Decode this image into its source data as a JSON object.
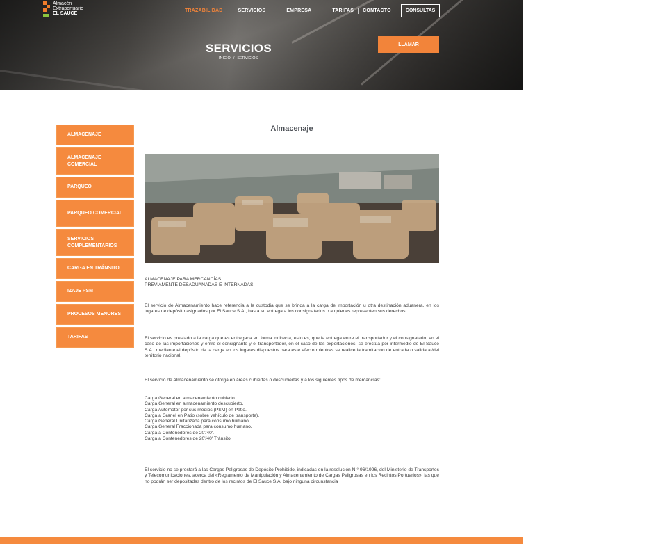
{
  "brand": {
    "logo_line1": "Almacén",
    "logo_line2": "Extraportuario",
    "logo_line3": "EL SAUCE",
    "accent_color": "#f58a3e"
  },
  "nav": {
    "items": [
      "TRAZABILIDAD",
      "SERVICIOS",
      "EMPRESA",
      "TARIFAS",
      "CONTACTO"
    ],
    "active": "TRAZABILIDAD",
    "cta": "CONSULTAS"
  },
  "hero": {
    "title": "SERVICIOS",
    "breadcrumb_home": "INICIO",
    "breadcrumb_sep": "/",
    "breadcrumb_current": "SERVICIOS",
    "call_button": "LLAMAR"
  },
  "sidebar": {
    "items": [
      "ALMACENAJE",
      "ALMACENAJE COMERCIAL",
      "PARQUEO",
      "PARQUEO COMERCIAL",
      "SERVICIOS COMPLEMENTARIOS",
      "CARGA EN TRÁNSITO",
      "IZAJE PSM",
      "PROCESOS MENORES",
      "TARIFAS"
    ]
  },
  "content": {
    "title": "Almacenaje",
    "subtitle_line1": "ALMACENAJE PARA MERCANCÍAS",
    "subtitle_line2": "PREVIAMENTE DESADUANADAS E INTERNADAS.",
    "p1": "El servicio de Almacenamiento hace referencia a la custodia que se brinda a la carga de importación u otra destinación aduanera, en los lugares de depósito asignados por El Sauce S.A., hasta su entrega a los consignatarios o a quienes representen sus derechos.",
    "p2": "El servicio es prestado a la carga que es entregada en forma indirecta, esto es, que la entrega entre el transportador y el consignatario, en el caso de las importaciones y entre el consignante y el transportador, en el caso de las exportaciones, se efectúa por intermedio de El Sauce S.A., mediante el depósito de la carga en los lugares dispuestos para este efecto mientras se realice la tramitación de entrada o salida al/del territorio nacional.",
    "p3": "El servicio de Almacenamiento se otorga en áreas cubiertas o descubiertas y a los siguientes tipos de mercancías:",
    "list": [
      "Carga General en almacenamiento cubierto.",
      "Carga General en almacenamiento descubierto.",
      "Carga Automotor por sus medios (PSM) en Patio.",
      "Carga a Granel en Patio (sobre vehículo de transporte).",
      "Carga General Unitarizada para consumo humano.",
      "Carga General Fraccionada para consumo humano.",
      "Carga a Contenedores de 20'/40'.",
      "Carga a Contenedores de 20'/40' Tránsito."
    ],
    "p4": "El servicio no se prestará a las Cargas Peligrosas de Depósito Prohibido, indicadas en la resolución N ° 96/1996, del Ministerio de Transportes y Telecomunicaciones, acerca del «Reglamento de Manipulación y Almacenamiento de Cargas Peligrosas en los Recintos Portuarios», las que no podrán ser depositadas dentro de los recintos de El Sauce S.A. bajo ninguna circunstancia"
  }
}
